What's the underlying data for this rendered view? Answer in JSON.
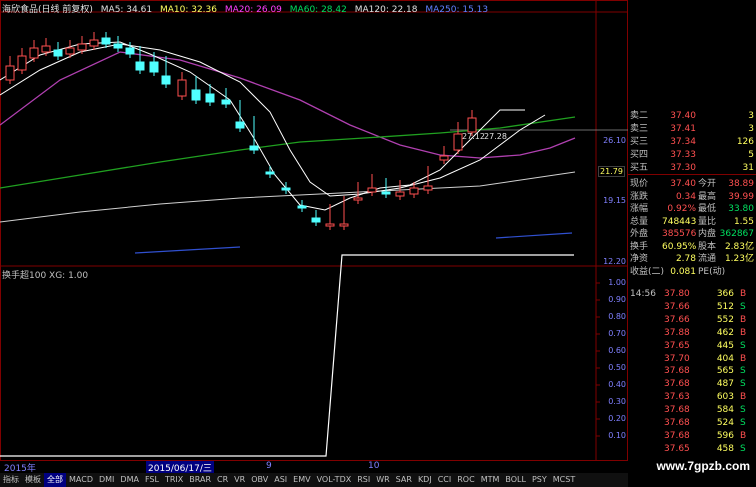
{
  "legend": {
    "stock": "海欣食品(日线 前复权)",
    "ma5": "MA5: 34.61",
    "ma10": "MA10: 32.36",
    "ma20": "MA20: 26.09",
    "ma60": "MA60: 28.42",
    "ma120": "MA120: 22.18",
    "ma250": "MA250: 15.13"
  },
  "colors": {
    "ma5": "#ffffff",
    "ma10": "#ffff00",
    "ma20": "#ff00ff",
    "ma60": "#00ff00",
    "ma120": "#e0e0e0",
    "ma250": "#4060ff",
    "up": "#ff5050",
    "down": "#50ffff"
  },
  "price_ticks": [
    "26.10",
    "19.15",
    "12.20"
  ],
  "current_price_tag": "21.79",
  "cross_label_left": "27.12",
  "cross_label_right": "27.28",
  "sub_chart": {
    "title": "换手超100 XG: 1.00",
    "ticks": [
      "1.00",
      "0.90",
      "0.80",
      "0.70",
      "0.60",
      "0.50",
      "0.40",
      "0.30",
      "0.20",
      "0.10"
    ]
  },
  "order_book": [
    {
      "label": "卖二",
      "price": "37.40",
      "vol": "3"
    },
    {
      "label": "卖三",
      "price": "37.41",
      "vol": "3"
    },
    {
      "label": "买三",
      "price": "37.34",
      "vol": "126"
    },
    {
      "label": "买四",
      "price": "37.33",
      "vol": "5"
    },
    {
      "label": "买五",
      "price": "37.30",
      "vol": "31"
    }
  ],
  "quote": [
    {
      "l1": "现价",
      "v1": "37.40",
      "l2": "今开",
      "v2": "38.89"
    },
    {
      "l1": "涨跌",
      "v1": "0.34",
      "l2": "最高",
      "v2": "39.99"
    },
    {
      "l1": "涨幅",
      "v1": "0.92%",
      "l2": "最低",
      "v2": "33.80"
    },
    {
      "l1": "总量",
      "v1": "748443",
      "l2": "量比",
      "v2": "1.55"
    },
    {
      "l1": "外盘",
      "v1": "385576",
      "l2": "内盘",
      "v2": "362867"
    },
    {
      "l1": "换手",
      "v1": "60.95%",
      "l2": "股本",
      "v2": "2.83亿"
    },
    {
      "l1": "净资",
      "v1": "2.78",
      "l2": "流通",
      "v2": "1.23亿"
    },
    {
      "l1": "收益(二)",
      "v1": "0.081",
      "l2": "PE(动)",
      "v2": ""
    }
  ],
  "ticks": [
    {
      "time": "14:56",
      "price": "37.80",
      "vol": "366",
      "side": "B"
    },
    {
      "time": "",
      "price": "37.66",
      "vol": "512",
      "side": "S"
    },
    {
      "time": "",
      "price": "37.66",
      "vol": "552",
      "side": "B"
    },
    {
      "time": "",
      "price": "37.88",
      "vol": "462",
      "side": "B"
    },
    {
      "time": "",
      "price": "37.65",
      "vol": "445",
      "side": "S"
    },
    {
      "time": "",
      "price": "37.70",
      "vol": "404",
      "side": "B"
    },
    {
      "time": "",
      "price": "37.68",
      "vol": "565",
      "side": "S"
    },
    {
      "time": "",
      "price": "37.68",
      "vol": "487",
      "side": "S"
    },
    {
      "time": "",
      "price": "37.63",
      "vol": "603",
      "side": "B"
    },
    {
      "time": "",
      "price": "37.68",
      "vol": "584",
      "side": "S"
    },
    {
      "time": "",
      "price": "37.68",
      "vol": "524",
      "side": "S"
    },
    {
      "time": "",
      "price": "37.68",
      "vol": "596",
      "side": "B"
    },
    {
      "time": "",
      "price": "37.65",
      "vol": "458",
      "side": "S"
    }
  ],
  "dates": {
    "year": "2015年",
    "cursor": "2015/06/17/三",
    "m9": "9",
    "m10": "10"
  },
  "tabs": [
    "指标",
    "模板",
    "全部",
    "MACD",
    "DMI",
    "DMA",
    "FSL",
    "TRIX",
    "BRAR",
    "CR",
    "VR",
    "OBV",
    "ASI",
    "EMV",
    "VOL-TDX",
    "RSI",
    "WR",
    "SAR",
    "KDJ",
    "CCI",
    "ROC",
    "MTM",
    "BOLL",
    "PSY",
    "MCST"
  ],
  "active_tab": "全部",
  "watermark": "www.7gpzb.com"
}
